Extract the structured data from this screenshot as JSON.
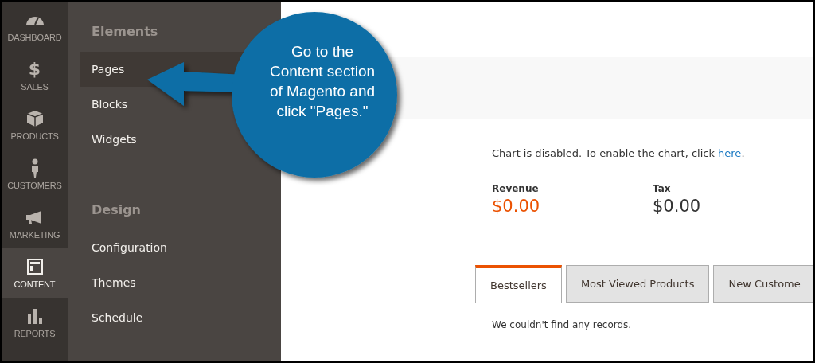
{
  "nav": [
    {
      "label": "DASHBOARD",
      "selected": false
    },
    {
      "label": "SALES",
      "glyph": "$",
      "selected": false
    },
    {
      "label": "PRODUCTS",
      "selected": false
    },
    {
      "label": "CUSTOMERS",
      "selected": false
    },
    {
      "label": "MARKETING",
      "selected": false
    },
    {
      "label": "CONTENT",
      "selected": true
    },
    {
      "label": "REPORTS",
      "selected": false
    }
  ],
  "flyout": {
    "sections": [
      {
        "title": "Elements",
        "items": [
          {
            "label": "Pages",
            "selected": true
          },
          {
            "label": "Blocks",
            "selected": false
          },
          {
            "label": "Widgets",
            "selected": false
          }
        ]
      },
      {
        "title": "Design",
        "items": [
          {
            "label": "Configuration",
            "selected": false
          },
          {
            "label": "Themes",
            "selected": false
          },
          {
            "label": "Schedule",
            "selected": false
          }
        ]
      }
    ]
  },
  "callout": {
    "lines": [
      "Go to the",
      "Content section",
      "of Magento and",
      "click \"Pages.\""
    ]
  },
  "dashboard": {
    "chart_notice": "Chart is disabled. To enable the chart, click",
    "chart_link": "here",
    "chart_notice_end": ".",
    "totals": [
      {
        "label": "Revenue",
        "value": "$0.00",
        "kind": "highlight"
      },
      {
        "label": "Tax",
        "value": "$0.00",
        "kind": "plain"
      }
    ],
    "tabs": [
      {
        "label": "Bestsellers",
        "selected": true
      },
      {
        "label": "Most Viewed Products",
        "selected": false
      },
      {
        "label": "New Custome",
        "selected": false
      }
    ],
    "empty_message": "We couldn't find any records."
  }
}
